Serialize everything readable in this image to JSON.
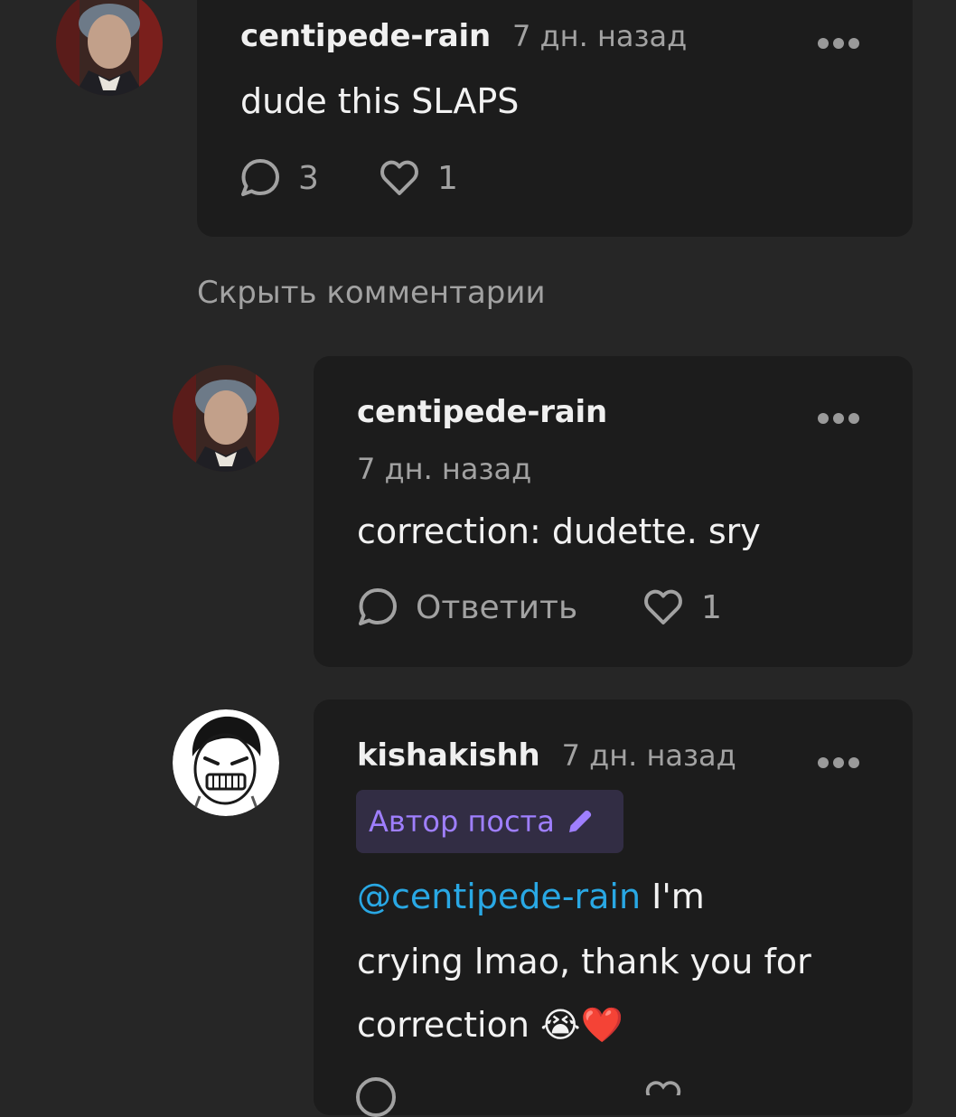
{
  "comment_1": {
    "username": "centipede-rain",
    "time": "7 дн. назад",
    "text": "dude this SLAPS",
    "reply_count": "3",
    "like_count": "1"
  },
  "hide_comments_label": "Скрыть комментарии",
  "reply_1": {
    "username": "centipede-rain",
    "time": "7 дн. назад",
    "text": "correction: dudette. sry",
    "reply_label": "Ответить",
    "like_count": "1"
  },
  "reply_2": {
    "username": "kishakishh",
    "time": "7 дн. назад",
    "badge": "Автор поста",
    "mention": "@centipede-rain",
    "text_line1_rest": " I'm",
    "text_line2": "crying lmao, thank you for",
    "text_line3": "correction",
    "emoji": "😭❤️"
  },
  "colors": {
    "background": "#262626",
    "card": "#1c1c1c",
    "mention": "#29a8e4",
    "badge_text": "#9f7fff",
    "badge_bg": "#322d44"
  },
  "icons": [
    "comment-icon",
    "heart-icon",
    "more-icon",
    "pencil-icon"
  ]
}
